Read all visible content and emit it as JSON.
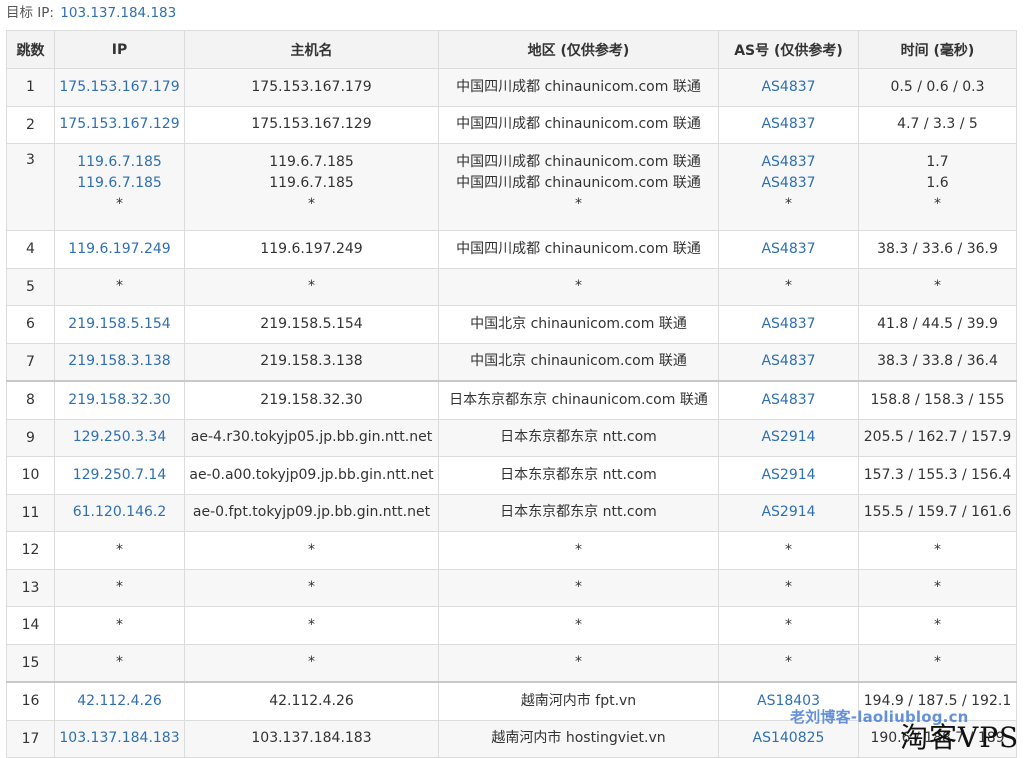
{
  "target": {
    "label": "目标 IP:",
    "ip": "103.137.184.183"
  },
  "headers": [
    "跳数",
    "IP",
    "主机名",
    "地区 (仅供参考)",
    "AS号 (仅供参考)",
    "时间 (毫秒)"
  ],
  "rows": [
    {
      "hop": "1",
      "ip": [
        "175.153.167.179"
      ],
      "host": [
        "175.153.167.179"
      ],
      "region": [
        "中国四川成都 chinaunicom.com 联通"
      ],
      "asn": [
        "AS4837"
      ],
      "time": [
        "0.5 / 0.6 / 0.3"
      ]
    },
    {
      "hop": "2",
      "ip": [
        "175.153.167.129"
      ],
      "host": [
        "175.153.167.129"
      ],
      "region": [
        "中国四川成都 chinaunicom.com 联通"
      ],
      "asn": [
        "AS4837"
      ],
      "time": [
        "4.7 / 3.3 / 5"
      ]
    },
    {
      "hop": "3",
      "ip": [
        "119.6.7.185",
        "119.6.7.185",
        "*"
      ],
      "host": [
        "119.6.7.185",
        "119.6.7.185",
        "*"
      ],
      "region": [
        "中国四川成都 chinaunicom.com 联通",
        "中国四川成都 chinaunicom.com 联通",
        "*"
      ],
      "asn": [
        "AS4837",
        "AS4837",
        "*"
      ],
      "time": [
        "1.7",
        "1.6",
        "*"
      ]
    },
    {
      "hop": "4",
      "ip": [
        "119.6.197.249"
      ],
      "host": [
        "119.6.197.249"
      ],
      "region": [
        "中国四川成都 chinaunicom.com 联通"
      ],
      "asn": [
        "AS4837"
      ],
      "time": [
        "38.3 / 33.6 / 36.9"
      ]
    },
    {
      "hop": "5",
      "ip": [
        "*"
      ],
      "host": [
        "*"
      ],
      "region": [
        "*"
      ],
      "asn": [
        "*"
      ],
      "time": [
        "*"
      ]
    },
    {
      "hop": "6",
      "ip": [
        "219.158.5.154"
      ],
      "host": [
        "219.158.5.154"
      ],
      "region": [
        "中国北京 chinaunicom.com 联通"
      ],
      "asn": [
        "AS4837"
      ],
      "time": [
        "41.8 / 44.5 / 39.9"
      ]
    },
    {
      "hop": "7",
      "ip": [
        "219.158.3.138"
      ],
      "host": [
        "219.158.3.138"
      ],
      "region": [
        "中国北京 chinaunicom.com 联通"
      ],
      "asn": [
        "AS4837"
      ],
      "time": [
        "38.3 / 33.8 / 36.4"
      ]
    },
    {
      "hop": "8",
      "ip": [
        "219.158.32.30"
      ],
      "host": [
        "219.158.32.30"
      ],
      "region": [
        "日本东京都东京 chinaunicom.com 联通"
      ],
      "asn": [
        "AS4837"
      ],
      "time": [
        "158.8 / 158.3 / 155"
      ]
    },
    {
      "hop": "9",
      "ip": [
        "129.250.3.34"
      ],
      "host": [
        "ae-4.r30.tokyjp05.jp.bb.gin.ntt.net"
      ],
      "region": [
        "日本东京都东京 ntt.com"
      ],
      "asn": [
        "AS2914"
      ],
      "time": [
        "205.5 / 162.7 / 157.9"
      ]
    },
    {
      "hop": "10",
      "ip": [
        "129.250.7.14"
      ],
      "host": [
        "ae-0.a00.tokyjp09.jp.bb.gin.ntt.net"
      ],
      "region": [
        "日本东京都东京 ntt.com"
      ],
      "asn": [
        "AS2914"
      ],
      "time": [
        "157.3 / 155.3 / 156.4"
      ]
    },
    {
      "hop": "11",
      "ip": [
        "61.120.146.2"
      ],
      "host": [
        "ae-0.fpt.tokyjp09.jp.bb.gin.ntt.net"
      ],
      "region": [
        "日本东京都东京 ntt.com"
      ],
      "asn": [
        "AS2914"
      ],
      "time": [
        "155.5 / 159.7 / 161.6"
      ]
    },
    {
      "hop": "12",
      "ip": [
        "*"
      ],
      "host": [
        "*"
      ],
      "region": [
        "*"
      ],
      "asn": [
        "*"
      ],
      "time": [
        "*"
      ]
    },
    {
      "hop": "13",
      "ip": [
        "*"
      ],
      "host": [
        "*"
      ],
      "region": [
        "*"
      ],
      "asn": [
        "*"
      ],
      "time": [
        "*"
      ]
    },
    {
      "hop": "14",
      "ip": [
        "*"
      ],
      "host": [
        "*"
      ],
      "region": [
        "*"
      ],
      "asn": [
        "*"
      ],
      "time": [
        "*"
      ]
    },
    {
      "hop": "15",
      "ip": [
        "*"
      ],
      "host": [
        "*"
      ],
      "region": [
        "*"
      ],
      "asn": [
        "*"
      ],
      "time": [
        "*"
      ]
    },
    {
      "hop": "16",
      "ip": [
        "42.112.4.26"
      ],
      "host": [
        "42.112.4.26"
      ],
      "region": [
        "越南河内市 fpt.vn"
      ],
      "asn": [
        "AS18403"
      ],
      "time": [
        "194.9 / 187.5 / 192.1"
      ]
    },
    {
      "hop": "17",
      "ip": [
        "103.137.184.183"
      ],
      "host": [
        "103.137.184.183"
      ],
      "region": [
        "越南河内市 hostingviet.vn"
      ],
      "asn": [
        "AS140825"
      ],
      "time": [
        "190.6 / 188.7 / 189"
      ]
    }
  ],
  "separators_before_hops": [
    "8",
    "16"
  ],
  "watermarks": {
    "blog": "老刘博客-laoliublog.cn",
    "site": "淘客VPS"
  },
  "colors": {
    "link": "#2f6fb3",
    "header_bg": "#f3f3f3",
    "row_alt": "#f7f7f7",
    "border": "#dcdcdc"
  }
}
